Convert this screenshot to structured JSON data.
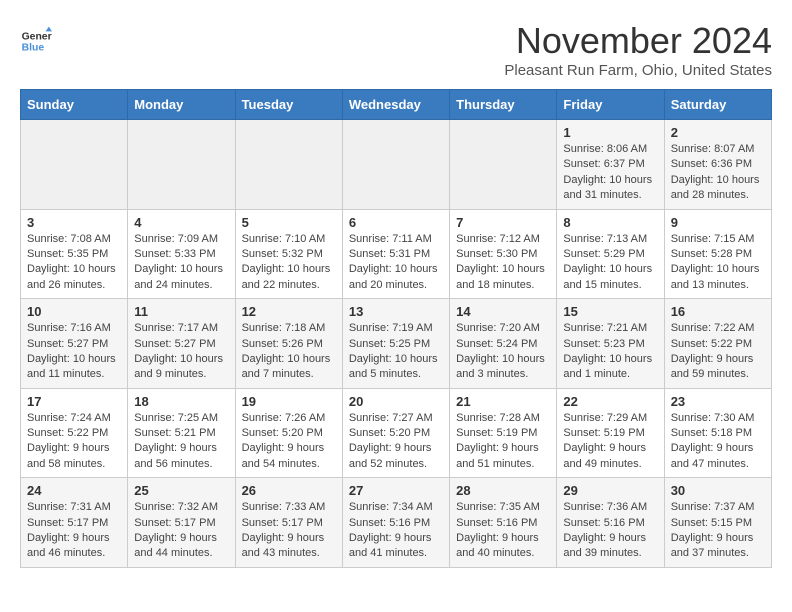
{
  "header": {
    "logo_line1": "General",
    "logo_line2": "Blue",
    "month_title": "November 2024",
    "subtitle": "Pleasant Run Farm, Ohio, United States"
  },
  "days_of_week": [
    "Sunday",
    "Monday",
    "Tuesday",
    "Wednesday",
    "Thursday",
    "Friday",
    "Saturday"
  ],
  "weeks": [
    [
      {
        "day": "",
        "info": ""
      },
      {
        "day": "",
        "info": ""
      },
      {
        "day": "",
        "info": ""
      },
      {
        "day": "",
        "info": ""
      },
      {
        "day": "",
        "info": ""
      },
      {
        "day": "1",
        "info": "Sunrise: 8:06 AM\nSunset: 6:37 PM\nDaylight: 10 hours and 31 minutes."
      },
      {
        "day": "2",
        "info": "Sunrise: 8:07 AM\nSunset: 6:36 PM\nDaylight: 10 hours and 28 minutes."
      }
    ],
    [
      {
        "day": "3",
        "info": "Sunrise: 7:08 AM\nSunset: 5:35 PM\nDaylight: 10 hours and 26 minutes."
      },
      {
        "day": "4",
        "info": "Sunrise: 7:09 AM\nSunset: 5:33 PM\nDaylight: 10 hours and 24 minutes."
      },
      {
        "day": "5",
        "info": "Sunrise: 7:10 AM\nSunset: 5:32 PM\nDaylight: 10 hours and 22 minutes."
      },
      {
        "day": "6",
        "info": "Sunrise: 7:11 AM\nSunset: 5:31 PM\nDaylight: 10 hours and 20 minutes."
      },
      {
        "day": "7",
        "info": "Sunrise: 7:12 AM\nSunset: 5:30 PM\nDaylight: 10 hours and 18 minutes."
      },
      {
        "day": "8",
        "info": "Sunrise: 7:13 AM\nSunset: 5:29 PM\nDaylight: 10 hours and 15 minutes."
      },
      {
        "day": "9",
        "info": "Sunrise: 7:15 AM\nSunset: 5:28 PM\nDaylight: 10 hours and 13 minutes."
      }
    ],
    [
      {
        "day": "10",
        "info": "Sunrise: 7:16 AM\nSunset: 5:27 PM\nDaylight: 10 hours and 11 minutes."
      },
      {
        "day": "11",
        "info": "Sunrise: 7:17 AM\nSunset: 5:27 PM\nDaylight: 10 hours and 9 minutes."
      },
      {
        "day": "12",
        "info": "Sunrise: 7:18 AM\nSunset: 5:26 PM\nDaylight: 10 hours and 7 minutes."
      },
      {
        "day": "13",
        "info": "Sunrise: 7:19 AM\nSunset: 5:25 PM\nDaylight: 10 hours and 5 minutes."
      },
      {
        "day": "14",
        "info": "Sunrise: 7:20 AM\nSunset: 5:24 PM\nDaylight: 10 hours and 3 minutes."
      },
      {
        "day": "15",
        "info": "Sunrise: 7:21 AM\nSunset: 5:23 PM\nDaylight: 10 hours and 1 minute."
      },
      {
        "day": "16",
        "info": "Sunrise: 7:22 AM\nSunset: 5:22 PM\nDaylight: 9 hours and 59 minutes."
      }
    ],
    [
      {
        "day": "17",
        "info": "Sunrise: 7:24 AM\nSunset: 5:22 PM\nDaylight: 9 hours and 58 minutes."
      },
      {
        "day": "18",
        "info": "Sunrise: 7:25 AM\nSunset: 5:21 PM\nDaylight: 9 hours and 56 minutes."
      },
      {
        "day": "19",
        "info": "Sunrise: 7:26 AM\nSunset: 5:20 PM\nDaylight: 9 hours and 54 minutes."
      },
      {
        "day": "20",
        "info": "Sunrise: 7:27 AM\nSunset: 5:20 PM\nDaylight: 9 hours and 52 minutes."
      },
      {
        "day": "21",
        "info": "Sunrise: 7:28 AM\nSunset: 5:19 PM\nDaylight: 9 hours and 51 minutes."
      },
      {
        "day": "22",
        "info": "Sunrise: 7:29 AM\nSunset: 5:19 PM\nDaylight: 9 hours and 49 minutes."
      },
      {
        "day": "23",
        "info": "Sunrise: 7:30 AM\nSunset: 5:18 PM\nDaylight: 9 hours and 47 minutes."
      }
    ],
    [
      {
        "day": "24",
        "info": "Sunrise: 7:31 AM\nSunset: 5:17 PM\nDaylight: 9 hours and 46 minutes."
      },
      {
        "day": "25",
        "info": "Sunrise: 7:32 AM\nSunset: 5:17 PM\nDaylight: 9 hours and 44 minutes."
      },
      {
        "day": "26",
        "info": "Sunrise: 7:33 AM\nSunset: 5:17 PM\nDaylight: 9 hours and 43 minutes."
      },
      {
        "day": "27",
        "info": "Sunrise: 7:34 AM\nSunset: 5:16 PM\nDaylight: 9 hours and 41 minutes."
      },
      {
        "day": "28",
        "info": "Sunrise: 7:35 AM\nSunset: 5:16 PM\nDaylight: 9 hours and 40 minutes."
      },
      {
        "day": "29",
        "info": "Sunrise: 7:36 AM\nSunset: 5:16 PM\nDaylight: 9 hours and 39 minutes."
      },
      {
        "day": "30",
        "info": "Sunrise: 7:37 AM\nSunset: 5:15 PM\nDaylight: 9 hours and 37 minutes."
      }
    ]
  ]
}
